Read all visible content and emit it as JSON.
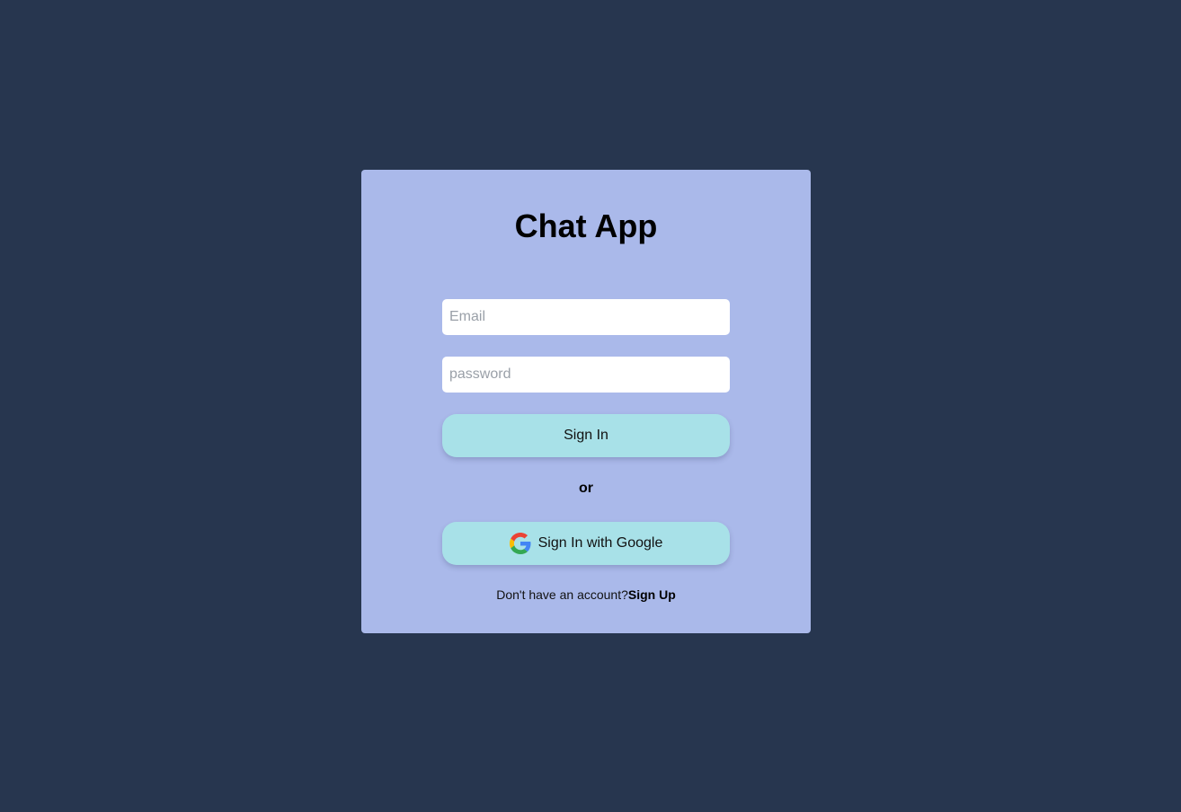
{
  "app": {
    "title": "Chat App"
  },
  "form": {
    "email_placeholder": "Email",
    "password_placeholder": "password",
    "sign_in_label": "Sign In",
    "divider_text": "or",
    "google_sign_in_label": "Sign In with Google"
  },
  "footer": {
    "prompt_text": "Don't have an account?",
    "sign_up_label": "Sign Up"
  },
  "icons": {
    "google": "google-icon"
  },
  "colors": {
    "page_background": "#27364f",
    "card_background": "#aab9ea",
    "button_background": "#a8e1e8",
    "input_background": "#ffffff"
  }
}
